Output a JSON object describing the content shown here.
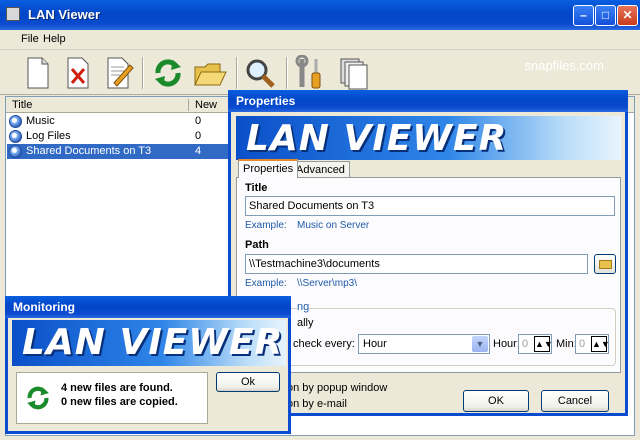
{
  "main_window": {
    "title": "LAN Viewer",
    "menu": [
      "File",
      "Help"
    ],
    "toolbar_icons": [
      "new-document-icon",
      "delete-icon",
      "edit-icon",
      "refresh-icon",
      "open-folder-icon",
      "search-icon",
      "settings-tools-icon",
      "copy-documents-icon"
    ],
    "watermark": "snapfiles.com"
  },
  "list": {
    "columns": [
      "Title",
      "New"
    ],
    "rows": [
      {
        "title": "Music",
        "new": "0"
      },
      {
        "title": "Log Files",
        "new": "0"
      },
      {
        "title": "Shared Documents on T3",
        "new": "4"
      }
    ]
  },
  "properties": {
    "title": "Properties",
    "banner": "LAN VIEWER",
    "tabs": [
      "Properties",
      "Advanced"
    ],
    "title_label": "Title",
    "title_value": "Shared Documents on T3",
    "title_example_label": "Example:",
    "title_example": "Music on Server",
    "path_label": "Path",
    "path_value": "\\\\Testmachine3\\documents",
    "path_example_label": "Example:",
    "path_example": "\\\\Server\\mp3\\",
    "group_label_partial": "ng",
    "auto_partial": "ally",
    "check_every_partial": "check every:",
    "interval": "Hour",
    "hour_label": "Hour:",
    "hour_value": "0",
    "min_label": "Min:",
    "min_value": "0",
    "notify_popup_partial": "on by popup window",
    "notify_email_partial": "on by e-mail",
    "ok": "OK",
    "cancel": "Cancel"
  },
  "monitoring": {
    "title": "Monitoring",
    "banner": "LAN VIEWER",
    "found": "4 new files are found.",
    "copied": "0 new files are copied.",
    "ok": "Ok"
  }
}
